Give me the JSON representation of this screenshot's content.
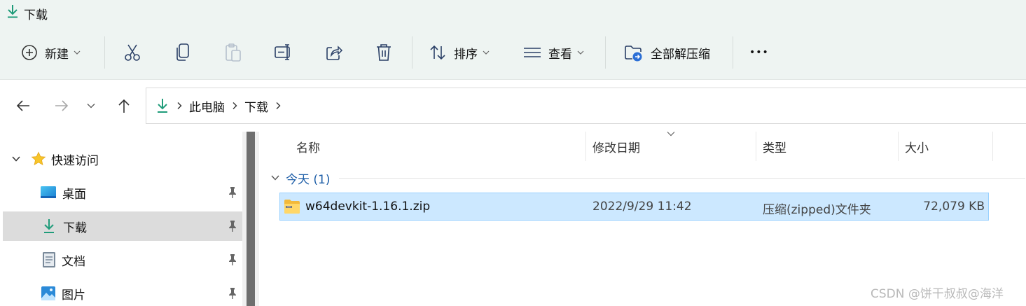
{
  "window": {
    "title": "下载",
    "icon": "download-arrow-icon"
  },
  "toolbar": {
    "new_label": "新建",
    "sort_label": "排序",
    "view_label": "查看",
    "extract_all_label": "全部解压缩",
    "more_label": "•••"
  },
  "address": {
    "crumbs": [
      "此电脑",
      "下载"
    ]
  },
  "sidebar": {
    "quick_access": "快速访问",
    "items": [
      {
        "label": "桌面",
        "icon": "desktop-icon"
      },
      {
        "label": "下载",
        "icon": "download-icon"
      },
      {
        "label": "文档",
        "icon": "document-icon"
      },
      {
        "label": "图片",
        "icon": "pictures-icon"
      }
    ]
  },
  "columns": {
    "name": "名称",
    "date": "修改日期",
    "type": "类型",
    "size": "大小"
  },
  "groups": [
    {
      "label": "今天 (1)",
      "files": [
        {
          "name": "w64devkit-1.16.1.zip",
          "date": "2022/9/29 11:42",
          "type": "压缩(zipped)文件夹",
          "size": "72,079 KB"
        }
      ]
    }
  ],
  "watermark": "CSDN @饼干叔叔@海洋",
  "colors": {
    "accent": "#1f9c7a",
    "selection": "#cce8ff",
    "selection_border": "#99d1ff",
    "command_bar": "#eef4f2",
    "nav_selected": "#dcdcdc"
  }
}
